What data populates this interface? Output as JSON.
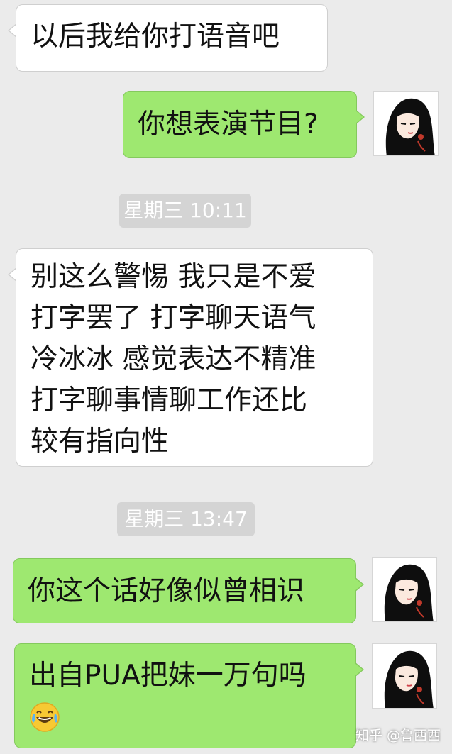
{
  "messages": {
    "m1": "以后我给你打语音吧",
    "m2": "你想表演节目?",
    "ts1": "星期三 10:11",
    "m3_lines": [
      "别这么警惕 我只是不爱",
      "打字罢了 打字聊天语气",
      "冷冰冰 感觉表达不精准",
      "打字聊事情聊工作还比",
      "较有指向性"
    ],
    "ts2": "星期三 13:47",
    "m4": "你这个话好像似曾相识",
    "m5": "出自PUA把妹一万句吗"
  },
  "icons": {
    "avatar": "avatar-illustration-icon",
    "emoji": "tears-of-joy-emoji-icon"
  },
  "watermark": {
    "site": "知乎",
    "author": "@鲁西西"
  },
  "colors": {
    "background": "#ebebeb",
    "bubble_left": "#ffffff",
    "bubble_right": "#9ee870",
    "timestamp_bg": "#d4d4d4"
  }
}
